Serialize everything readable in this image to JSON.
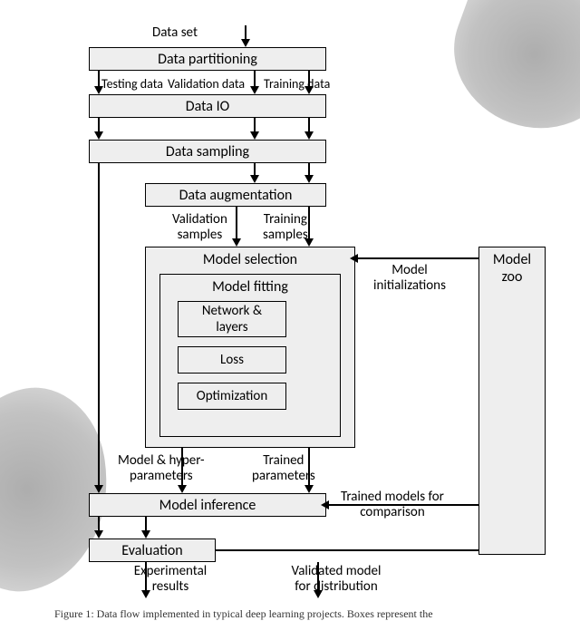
{
  "labels": {
    "data_set": "Data set",
    "testing_data": "Testing data",
    "validation_data": "Validation data",
    "training_data": "Training data",
    "validation_samples": "Validation\nsamples",
    "training_samples": "Training\nsamples",
    "model_initializations": "Model\ninitializations",
    "model_hyper_params": "Model & hyper-\nparameters",
    "trained_params": "Trained\nparameters",
    "trained_models_for_comparison": "Trained models for\ncomparison",
    "experimental_results": "Experimental\nresults",
    "validated_model_for_distribution": "Validated model\nfor distribution"
  },
  "boxes": {
    "data_partitioning": "Data partitioning",
    "data_io": "Data IO",
    "data_sampling": "Data sampling",
    "data_augmentation": "Data augmentation",
    "model_selection": "Model selection",
    "model_fitting": "Model fitting",
    "network_layers": "Network &\nlayers",
    "loss": "Loss",
    "optimization": "Optimization",
    "model_zoo": "Model\nzoo",
    "model_inference": "Model inference",
    "evaluation": "Evaluation"
  },
  "caption": "Figure 1:  Data flow implemented in typical deep learning projects.  Boxes represent the"
}
